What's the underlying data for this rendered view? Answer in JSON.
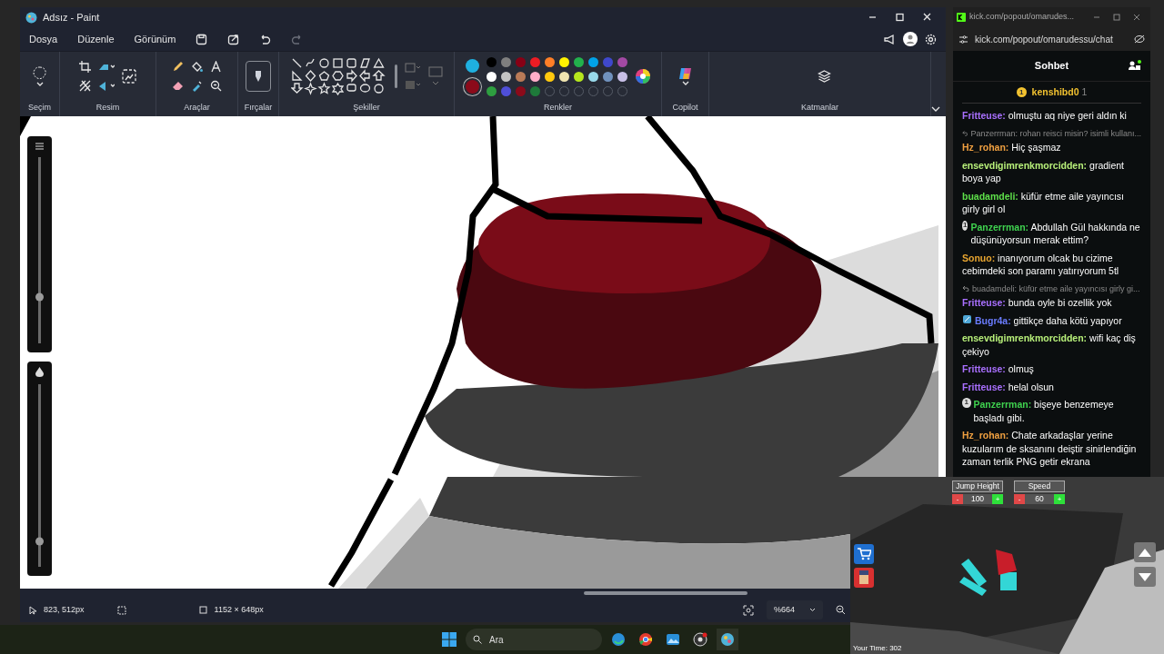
{
  "paint": {
    "title": "Adsız - Paint",
    "menu": [
      "Dosya",
      "Düzenle",
      "Görünüm"
    ],
    "groups": [
      "Seçim",
      "Resim",
      "Araçlar",
      "Fırçalar",
      "Şekiller",
      "Renkler",
      "Copilot",
      "Katmanlar"
    ],
    "active_colors": [
      {
        "color": "#1fb0e0"
      },
      {
        "color": "#8b0a1a"
      }
    ],
    "palette": [
      {
        "color": "#000000"
      },
      {
        "color": "#7f7f7f"
      },
      {
        "color": "#880015"
      },
      {
        "color": "#ed1c24"
      },
      {
        "color": "#ff7f27"
      },
      {
        "color": "#fff200"
      },
      {
        "color": "#22b14c"
      },
      {
        "color": "#00a2e8"
      },
      {
        "color": "#3f48cc"
      },
      {
        "color": "#a349a4"
      },
      {
        "color": "#ffffff"
      },
      {
        "color": "#c3c3c3"
      },
      {
        "color": "#b97a57"
      },
      {
        "color": "#ffaec9"
      },
      {
        "color": "#ffc90e"
      },
      {
        "color": "#efe4b0"
      },
      {
        "color": "#b5e61d"
      },
      {
        "color": "#99d9ea"
      },
      {
        "color": "#7092be"
      },
      {
        "color": "#c8bfe7"
      },
      {
        "color": "#2e9e40"
      },
      {
        "color": "#4f4fd8"
      },
      {
        "color": "#8b0a1a"
      },
      {
        "color": "#1e7a3a"
      },
      {
        "kind": "empty"
      },
      {
        "kind": "empty"
      },
      {
        "kind": "empty"
      },
      {
        "kind": "empty"
      },
      {
        "kind": "empty"
      },
      {
        "kind": "empty"
      }
    ],
    "size_slider": {
      "level": 0.25
    },
    "opacity_slider": {
      "level": 0.14
    },
    "status": {
      "cursor": "823, 512px",
      "canvas_size": "1152 × 648px",
      "zoom": "%664"
    }
  },
  "chat": {
    "tab_title": "kick.com/popout/omarudes...",
    "url": "kick.com/popout/omarudessu/chat",
    "header": "Sohbet",
    "pinned": {
      "badge": "1",
      "user": "kenshibd0",
      "count": "1"
    },
    "messages": [
      {
        "kind": "message",
        "user": "Fritteuse:",
        "color": "#a970ff",
        "text": "olmuştu aq niye geri aldın ki"
      },
      {
        "kind": "reply",
        "text": "Panzerrman: rohan reisci misin? isimli kullanı..."
      },
      {
        "kind": "message",
        "user": "Hz_rohan:",
        "color": "#f0a040",
        "text": "Hiç şaşmaz"
      },
      {
        "kind": "message",
        "user": "ensevdigimrenkmorcidden:",
        "color": "#b8f07a",
        "text": "gradient boya yap"
      },
      {
        "kind": "message",
        "user": "buadamdeli:",
        "color": "#5ee04a",
        "text": "küfür etme aile yayıncısı girly girl ol"
      },
      {
        "kind": "message",
        "user": "Panzerrman:",
        "color": "#3fd24f",
        "text": "Abdullah Gül hakkında ne düşünüyorsun merak ettim?",
        "badge": {
          "kind": "gift",
          "text": "1"
        }
      },
      {
        "kind": "message",
        "user": "Sonuo:",
        "color": "#e8a530",
        "text": "inanıyorum olcak bu cizime cebimdeki son paramı yatırıyorum 5tl"
      },
      {
        "kind": "reply",
        "text": "buadamdeli: küfür etme aile yayıncısı girly gi..."
      },
      {
        "kind": "message",
        "user": "Fritteuse:",
        "color": "#a970ff",
        "text": "bunda oyle bi ozellik yok"
      },
      {
        "kind": "message",
        "user": "Bugr4a:",
        "color": "#6a7cff",
        "text": "gittikçe daha kötü yapıyor",
        "badge": {
          "kind": "emblem"
        }
      },
      {
        "kind": "message",
        "user": "ensevdigimrenkmorcidden:",
        "color": "#b8f07a",
        "text": "wifi kaç diş çekiyo"
      },
      {
        "kind": "message",
        "user": "Fritteuse:",
        "color": "#a970ff",
        "text": "olmuş"
      },
      {
        "kind": "message",
        "user": "Fritteuse:",
        "color": "#a970ff",
        "text": "helal olsun"
      },
      {
        "kind": "message",
        "user": "Panzerrman:",
        "color": "#3fd24f",
        "text": "bişeye benzemeye başladı gibi.",
        "badge": {
          "kind": "gift",
          "text": "1"
        }
      },
      {
        "kind": "message",
        "user": "Hz_rohan:",
        "color": "#f0a040",
        "text": "Chate arkadaşlar yerine kuzularım de sksanını deiştir sinirlendiğin zaman terlik PNG getir ekrana"
      }
    ]
  },
  "game": {
    "stats": [
      {
        "label": "Jump Height",
        "decrease": "-",
        "value": "100",
        "increase": "+"
      },
      {
        "label": "Speed",
        "decrease": "-",
        "value": "60",
        "increase": "+"
      }
    ],
    "time": "Your Time: 302"
  },
  "taskbar": {
    "search": "Ara"
  }
}
